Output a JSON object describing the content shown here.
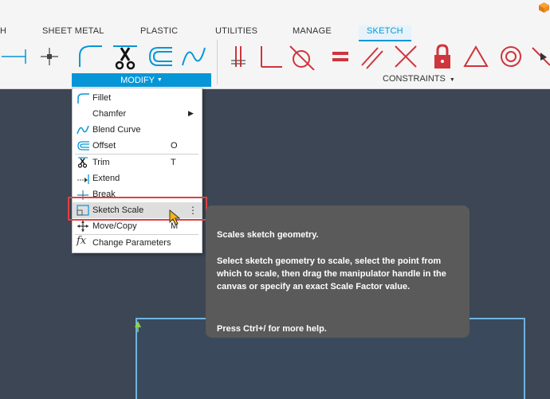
{
  "ribbon": {
    "tabs": [
      {
        "label": "H"
      },
      {
        "label": "SHEET METAL"
      },
      {
        "label": "PLASTIC"
      },
      {
        "label": "UTILITIES"
      },
      {
        "label": "MANAGE"
      },
      {
        "label": "SKETCH",
        "active": true
      }
    ],
    "modify_label": "MODIFY",
    "constraints_label": "CONSTRAINTS"
  },
  "modify_menu": {
    "items": [
      {
        "label": "Fillet",
        "shortcut": "",
        "icon": "fillet-icon"
      },
      {
        "label": "Chamfer",
        "shortcut": "",
        "icon": "chamfer-icon",
        "submenu": true
      },
      {
        "label": "Blend Curve",
        "shortcut": "",
        "icon": "blend-curve-icon"
      },
      {
        "label": "Offset",
        "shortcut": "O",
        "icon": "offset-icon"
      },
      {
        "label": "Trim",
        "shortcut": "T",
        "icon": "trim-scissors-icon"
      },
      {
        "label": "Extend",
        "shortcut": "",
        "icon": "extend-icon"
      },
      {
        "label": "Break",
        "shortcut": "",
        "icon": "break-icon"
      },
      {
        "label": "Sketch Scale",
        "shortcut": "",
        "icon": "sketch-scale-icon",
        "hovered": true
      },
      {
        "label": "Move/Copy",
        "shortcut": "M",
        "icon": "move-copy-icon"
      },
      {
        "label": "Change Parameters",
        "shortcut": "",
        "icon": "fx-icon"
      }
    ]
  },
  "tooltip": {
    "title": "Scales sketch geometry.",
    "body": "Select sketch geometry to scale, select the point from which to scale, then drag the manipulator handle in the canvas or specify an exact Scale Factor value.",
    "help": "Press Ctrl+/ for more help."
  },
  "colors": {
    "accent": "#0696d7",
    "highlight": "#e04040",
    "canvas": "#3c4654",
    "tooltip_bg": "#5a5a5a",
    "constraint_red": "#d0343c"
  }
}
